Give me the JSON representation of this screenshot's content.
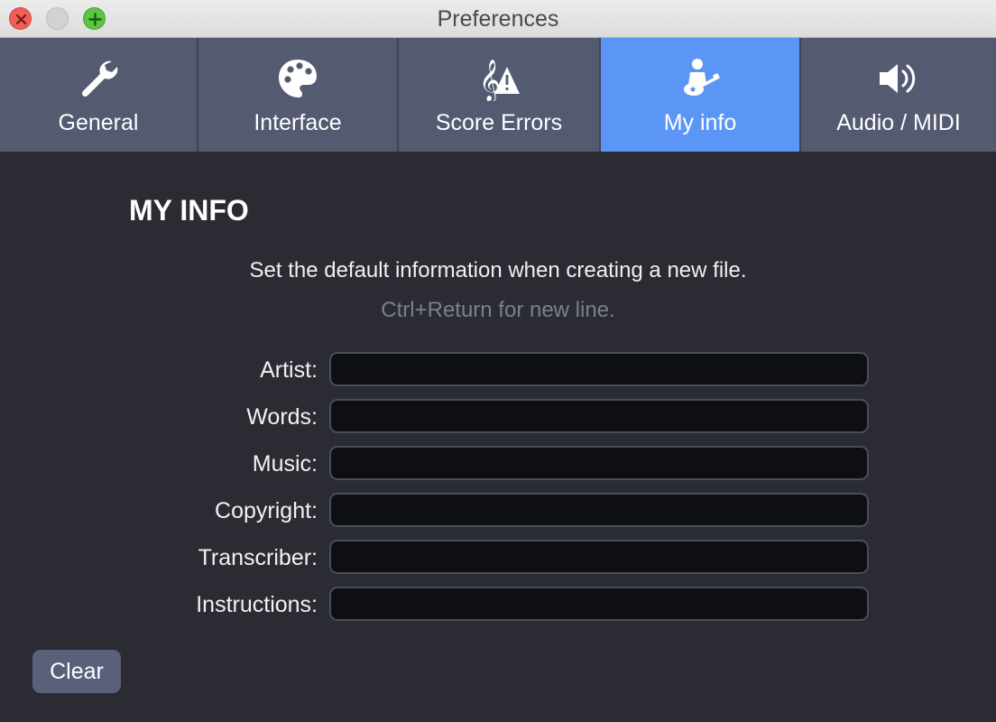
{
  "window": {
    "title": "Preferences"
  },
  "tabs": [
    {
      "label": "General",
      "icon": "wrench-icon",
      "active": false
    },
    {
      "label": "Interface",
      "icon": "palette-icon",
      "active": false
    },
    {
      "label": "Score Errors",
      "icon": "treble-clef-warning-icon",
      "active": false
    },
    {
      "label": "My info",
      "icon": "person-guitar-icon",
      "active": true
    },
    {
      "label": "Audio / MIDI",
      "icon": "speaker-icon",
      "active": false
    }
  ],
  "main": {
    "heading": "MY INFO",
    "description": "Set the default information when creating a new file.",
    "hint": "Ctrl+Return for new line.",
    "fields": [
      {
        "label": "Artist:",
        "value": ""
      },
      {
        "label": "Words:",
        "value": ""
      },
      {
        "label": "Music:",
        "value": ""
      },
      {
        "label": "Copyright:",
        "value": ""
      },
      {
        "label": "Transcriber:",
        "value": ""
      },
      {
        "label": "Instructions:",
        "value": ""
      }
    ],
    "clear_label": "Clear"
  },
  "colors": {
    "active_tab": "#5b96f7",
    "toolbar": "#545a70",
    "background": "#2b2c33"
  }
}
